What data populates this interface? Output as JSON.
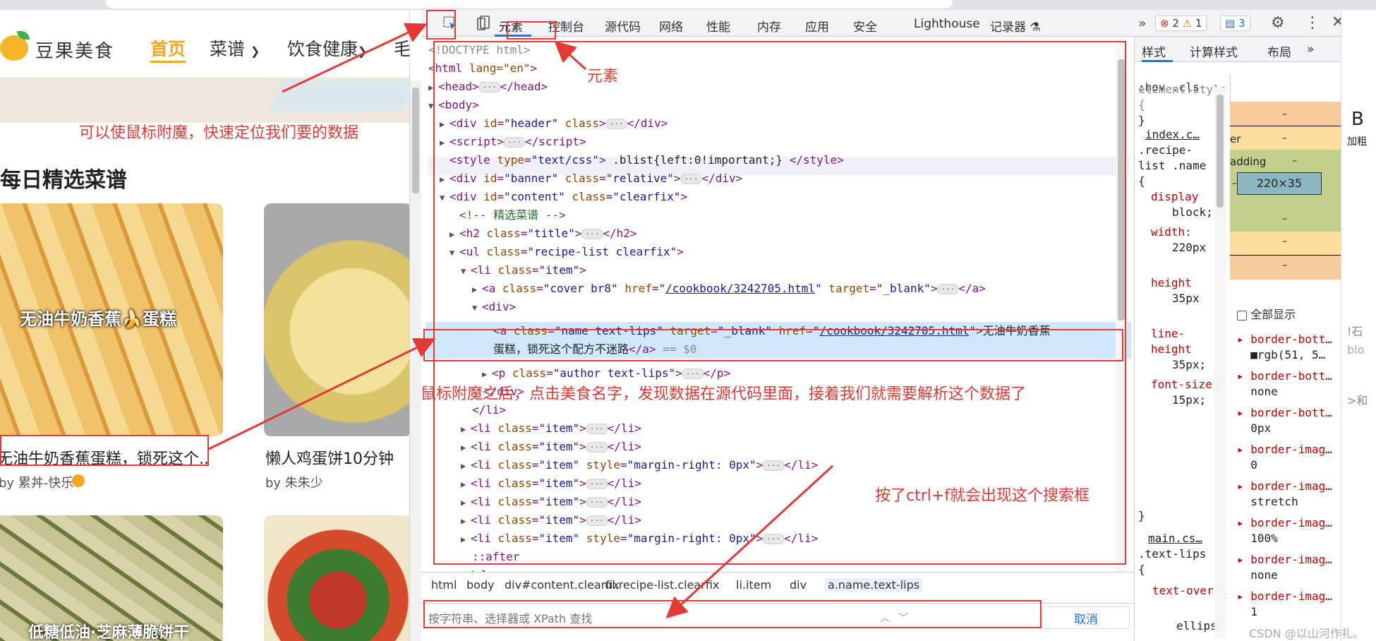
{
  "site": {
    "logo_text": "豆果美食",
    "nav": {
      "home": "首页",
      "recipes": "菜谱",
      "health": "饮食健康",
      "more": "毛"
    },
    "annotation": "可以使鼠标附魔，快速定位我们要的数据",
    "section_title": "每日精选菜谱",
    "cards": [
      {
        "overlay": "无油牛奶香蕉🍌蛋糕",
        "title": "无油牛奶香蕉蛋糕，锁死这个..",
        "author": "by 累丼-快乐"
      },
      {
        "title": "懒人鸡蛋饼10分钟",
        "author": "by 朱朱少"
      },
      {
        "overlay": "低糖低油·芝麻薄脆饼干"
      }
    ]
  },
  "devtools": {
    "tabs": {
      "elements": "元素",
      "console": "控制台",
      "sources": "源代码",
      "network": "网络",
      "performance": "性能",
      "memory": "内存",
      "application": "应用",
      "security": "安全",
      "lighthouse": "Lighthouse",
      "recorder": "记录器 ⚗"
    },
    "tabs_more": "»",
    "errors": "2",
    "warnings": "1",
    "messages": "3",
    "dom": {
      "doctype": "<!DOCTYPE html>",
      "html_open": "lang=\"en\"",
      "style_text": ".blist{left:0!important;}",
      "comment": "<!-- 精选菜谱 -->",
      "cover_href": "/cookbook/3242705.html",
      "name_href": "/cookbook/3242705.html",
      "name_text_1": "无油牛奶香蕉",
      "name_text_2": "蛋糕，锁死这个配方不迷路",
      "eq": "== $0",
      "after": "::after"
    },
    "breadcrumb": [
      "html",
      "body",
      "div#content.clearfix",
      "ul.recipe-list.clearfix",
      "li.item",
      "div",
      "a.name.text-lips"
    ],
    "search_placeholder": "按字符串、选择器或 XPath 查找",
    "cancel": "取消",
    "styles_tabs": {
      "styles": "样式",
      "computed": "计算样式",
      "layout": "布局",
      "more": "»"
    },
    "filter": ":hov  .cls",
    "styles": {
      "element_style": "element.style {",
      "close": "}",
      "source1": "index.c…",
      "selector1a": ".recipe-",
      "selector1b": "list .name",
      "open": "{",
      "decls": [
        {
          "prop": "display",
          "val": "block;"
        },
        {
          "prop": "width",
          "val": "220px"
        },
        {
          "prop": "height",
          "val": "35px"
        },
        {
          "prop": "line-height",
          "val": "35px;"
        },
        {
          "prop": "font-size",
          "val": "15px;"
        }
      ],
      "source2": "main.cs…",
      "selector2": ".text-lips",
      "decl2_prop": "text-overfl",
      "decl2_val": "ellips"
    },
    "box_model": {
      "content": "220×35",
      "margin_label": "er",
      "padding_label": "adding",
      "dash": "–"
    },
    "computed": {
      "show_all": "全部显示",
      "props": [
        {
          "prop": "border-bott…",
          "val": "■rgb(51, 5…"
        },
        {
          "prop": "border-bott…",
          "val": "none"
        },
        {
          "prop": "border-bott…",
          "val": "0px"
        },
        {
          "prop": "border-imag…",
          "val": "0"
        },
        {
          "prop": "border-imag…",
          "val": "stretch"
        },
        {
          "prop": "border-imag…",
          "val": "100%"
        },
        {
          "prop": "border-imag…",
          "val": "none"
        },
        {
          "prop": "border-imag…",
          "val": "1"
        }
      ]
    }
  },
  "annotations": {
    "elements": "元素",
    "after_hover": "鼠标附魔之后，点击美食名字，发现数据在源代码里面，接着我们就需要解析这个数据了",
    "ctrlf": "按了ctrl+f就会出现这个搜索框"
  },
  "edge": {
    "bold": "B",
    "bold_label": "加粗",
    "text1": "!石",
    "text2": "blo",
    "text3": ">和"
  },
  "watermark": "CSDN @以山河作礼。",
  "colors": {
    "accent": "#f5a623",
    "annotation": "#e53935",
    "devtools_link": "#1a73e8"
  }
}
